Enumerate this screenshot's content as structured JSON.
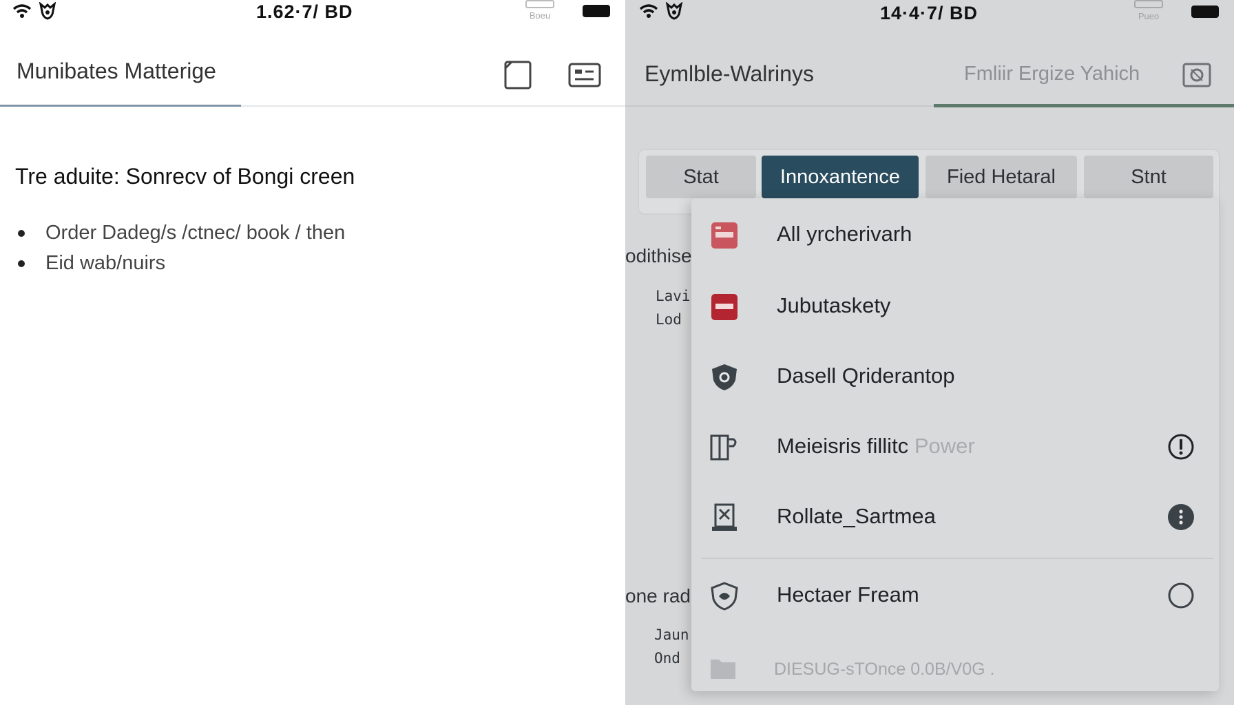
{
  "colors": {
    "accent_dark": "#294c5e",
    "underline_left": "#7f95a6",
    "underline_right": "#5e7a6c",
    "icon_red": "#b32530",
    "icon_dark": "#3b4248"
  },
  "left": {
    "status": {
      "time": "1.62·7/ BD"
    },
    "header": {
      "title": "Munibates Matterige",
      "icons": [
        "square-outline-icon",
        "keyboard-card-icon"
      ]
    },
    "note": {
      "title": "Tre aduite: Sonrecv of Bongi creen",
      "bullets": [
        "Order Dadeg/s /ctnec/ book / then",
        "Eid wab/nuirs"
      ]
    }
  },
  "right": {
    "status": {
      "time": "14·4·7/ BD"
    },
    "header": {
      "title": "Eymlble-Walrinys",
      "secondary_tab": "Fmliir Ergize Yahich",
      "icon": "settings-panel-icon"
    },
    "tabs": [
      {
        "label": "Stat",
        "active": false
      },
      {
        "label": "Innoxantence",
        "active": true
      },
      {
        "label": "Fied Hetaral",
        "active": false
      },
      {
        "label": "Stnt",
        "active": false
      }
    ],
    "background": {
      "text1": "odithise",
      "text2": "Lavi",
      "text3": "Lod -",
      "text4": "one rad",
      "text5": "Jaun",
      "text6": "Ond -"
    },
    "menu": {
      "items": [
        {
          "label": "All yrcherivarh",
          "icon": "red-card-icon",
          "trailing": ""
        },
        {
          "label": "Jubutaskety",
          "icon": "red-window-icon",
          "trailing": ""
        },
        {
          "label": "Dasell Qriderantop",
          "icon": "shield-gear-icon",
          "trailing": ""
        },
        {
          "label": "Meieisris fillitc",
          "label_faded": "Power",
          "icon": "door-exit-icon",
          "trailing": "alert-circle-icon"
        },
        {
          "label": "Rollate_Sartmea",
          "icon": "tower-device-icon",
          "trailing": "more-dots-icon"
        },
        {
          "label": "Hectaer Fream",
          "icon": "shield-badge-icon",
          "trailing": "radio-empty-icon"
        }
      ],
      "footer": {
        "label": "DIESUG-sTOnce 0.0B/V0G .",
        "icon": "folder-icon"
      }
    }
  }
}
